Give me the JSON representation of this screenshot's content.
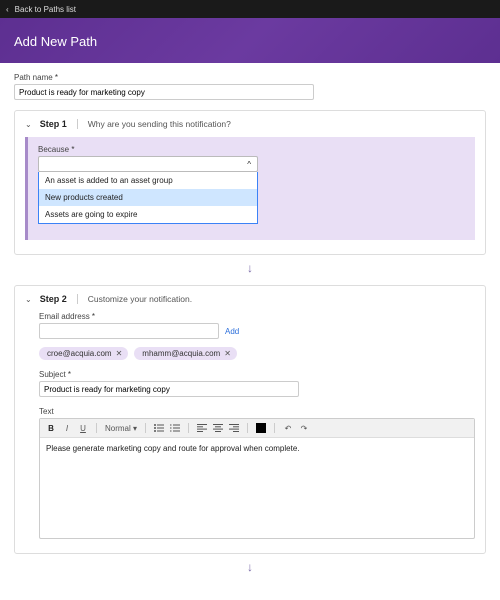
{
  "topbar": {
    "back_label": "Back to Paths list"
  },
  "hero": {
    "title": "Add New Path"
  },
  "path_name": {
    "label": "Path name",
    "value": "Product is ready for marketing copy"
  },
  "step1": {
    "title": "Step 1",
    "subtitle": "Why are you sending this notification?",
    "because_label": "Because",
    "select_value": "",
    "options": {
      "0": "An asset is added to an asset group",
      "1": "New products created",
      "2": "Assets are going to expire"
    },
    "selected_index": 1
  },
  "step2": {
    "title": "Step 2",
    "subtitle": "Customize your notification.",
    "email_label": "Email address",
    "email_value": "",
    "add_label": "Add",
    "chips": {
      "0": "croe@acquia.com",
      "1": "mhamm@acquia.com"
    },
    "subject_label": "Subject",
    "subject_value": "Product is ready for marketing copy",
    "text_label": "Text",
    "toolbar": {
      "normal_label": "Normal"
    },
    "body": "Please generate marketing copy and route for approval when complete."
  }
}
